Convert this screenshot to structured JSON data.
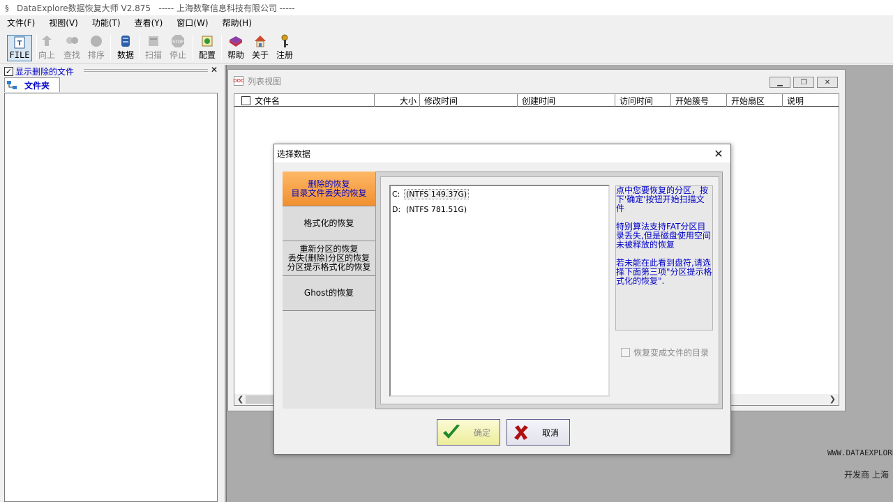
{
  "window": {
    "title": "DataExplore数据恢复大师 V2.875   ----- 上海数擎信息科技有限公司 -----"
  },
  "menu": [
    "文件(F)",
    "视图(V)",
    "功能(T)",
    "查看(Y)",
    "窗口(W)",
    "帮助(H)"
  ],
  "toolbar": {
    "file": "FILE",
    "up": "向上",
    "find": "查找",
    "sort": "排序",
    "data": "数据",
    "scan": "扫描",
    "stop": "停止",
    "config": "配置",
    "help": "帮助",
    "about": "关于",
    "register": "注册"
  },
  "left_panel": {
    "show_deleted_label": "显示删除的文件",
    "show_deleted_checked": true,
    "folder_tab": "文件夹"
  },
  "list_view": {
    "title": "列表视图",
    "columns": [
      "文件名",
      "大小",
      "修改时间",
      "创建时间",
      "访问时间",
      "开始簇号",
      "开始扇区",
      "说明"
    ]
  },
  "footer": {
    "website": "WWW.DATAEXPLORE",
    "developer": "开发商   上海"
  },
  "dialog": {
    "title": "选择数据",
    "tabs": [
      {
        "lines": [
          "删除的恢复",
          "目录文件丢失的恢复"
        ],
        "active": true
      },
      {
        "lines": [
          "格式化的恢复"
        ],
        "active": false
      },
      {
        "lines": [
          "重新分区的恢复",
          "丢失(删除)分区的恢复",
          "分区提示格式化的恢复"
        ],
        "active": false
      },
      {
        "lines": [
          "Ghost的恢复"
        ],
        "active": false
      }
    ],
    "drives": [
      {
        "letter": "C:",
        "info": "(NTFS 149.37G)",
        "selected": true
      },
      {
        "letter": "D:",
        "info": "(NTFS 781.51G)",
        "selected": false
      }
    ],
    "info_paragraphs": [
      "点中您要恢复的分区，按下'确定'按钮开始扫描文件",
      "特别算法支持FAT分区目录丢失,但是磁盘使用空间未被释放的恢复",
      "若未能在此看到盘符,请选择下面第三项\"分区提示格式化的恢复\"."
    ],
    "recover_dir_label": "恢复变成文件的目录",
    "recover_dir_checked": false,
    "ok_label": "确定",
    "cancel_label": "取消"
  }
}
